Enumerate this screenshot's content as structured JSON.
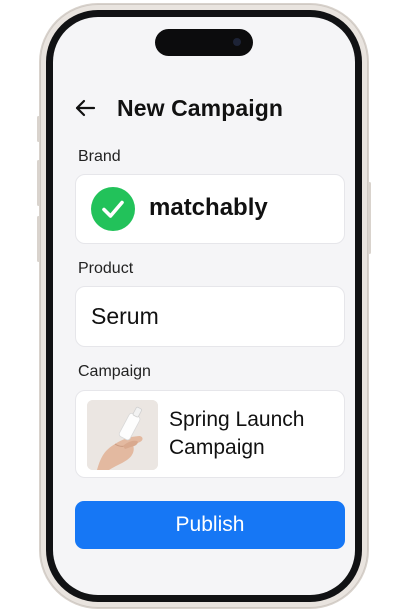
{
  "header": {
    "title": "New Campaign"
  },
  "brand": {
    "label": "Brand",
    "name": "matchably"
  },
  "product": {
    "label": "Product",
    "value": "Serum"
  },
  "campaign": {
    "label": "Campaign",
    "name_line1": "Spring Launch",
    "name_line2": "Campaign"
  },
  "actions": {
    "publish_label": "Publish"
  },
  "colors": {
    "accent": "#1677f5",
    "success": "#22c25a",
    "background": "#f5f5f7"
  },
  "icons": {
    "back": "arrow-left-icon",
    "verified": "check-circle-icon"
  }
}
